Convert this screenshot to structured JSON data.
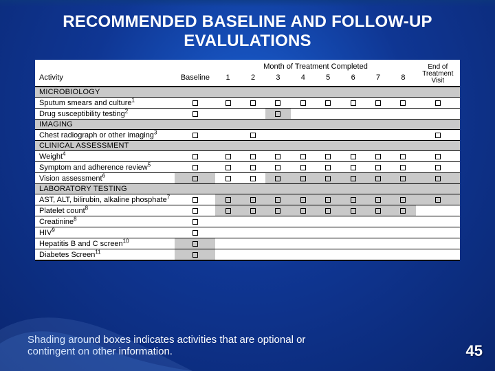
{
  "title_line1": "RECOMMENDED BASELINE AND FOLLOW-UP",
  "title_line2": "EVALULATIONS",
  "page": "45",
  "caption": "Shading around boxes indicates activities that are optional or contingent on other information.",
  "columns": {
    "activity": "Activity",
    "baseline": "Baseline",
    "month_header": "Month of Treatment Completed",
    "months": [
      "1",
      "2",
      "3",
      "4",
      "5",
      "6",
      "7",
      "8"
    ],
    "end_line1": "End of",
    "end_line2": "Treatment",
    "end_line3": "Visit"
  },
  "sections": [
    {
      "name": "MICROBIOLOGY",
      "rows": [
        {
          "label": "Sputum smears and culture",
          "sup": "1",
          "marks": {
            "baseline": true,
            "m": [
              true,
              true,
              true,
              true,
              true,
              true,
              true,
              true
            ],
            "end": true
          },
          "shade": {}
        },
        {
          "label": "Drug susceptibility testing",
          "sup": "2",
          "marks": {
            "baseline": true,
            "m": [
              false,
              false,
              true,
              false,
              false,
              false,
              false,
              false
            ],
            "end": false
          },
          "shade": {
            "3": true
          }
        }
      ]
    },
    {
      "name": "IMAGING",
      "rows": [
        {
          "label": "Chest radiograph or other imaging",
          "sup": "3",
          "marks": {
            "baseline": true,
            "m": [
              false,
              true,
              false,
              false,
              false,
              false,
              false,
              false
            ],
            "end": true
          },
          "shade": {}
        }
      ]
    },
    {
      "name": "CLINICAL ASSESSMENT",
      "rows": [
        {
          "label": "Weight",
          "sup": "4",
          "marks": {
            "baseline": true,
            "m": [
              true,
              true,
              true,
              true,
              true,
              true,
              true,
              true
            ],
            "end": true
          },
          "shade": {}
        },
        {
          "label": "Symptom and adherence review",
          "sup": "5",
          "marks": {
            "baseline": true,
            "m": [
              true,
              true,
              true,
              true,
              true,
              true,
              true,
              true
            ],
            "end": true
          },
          "shade": {}
        },
        {
          "label": "Vision assessment",
          "sup": "6",
          "marks": {
            "baseline": true,
            "m": [
              true,
              true,
              true,
              true,
              true,
              true,
              true,
              true
            ],
            "end": true
          },
          "shade": {
            "baseline": true,
            "3": true,
            "4": true,
            "5": true,
            "6": true,
            "7": true,
            "8": true,
            "end": true
          }
        }
      ]
    },
    {
      "name": "LABORATORY TESTING",
      "rows": [
        {
          "label": "AST, ALT, bilirubin, alkaline phosphate",
          "sup": "7",
          "marks": {
            "baseline": true,
            "m": [
              true,
              true,
              true,
              true,
              true,
              true,
              true,
              true
            ],
            "end": true
          },
          "shade": {
            "1": true,
            "2": true,
            "3": true,
            "4": true,
            "5": true,
            "6": true,
            "7": true,
            "8": true,
            "end": true
          }
        },
        {
          "label": "Platelet count",
          "sup": "8",
          "marks": {
            "baseline": true,
            "m": [
              true,
              true,
              true,
              true,
              true,
              true,
              true,
              true
            ],
            "end": false
          },
          "shade": {
            "1": true,
            "2": true,
            "3": true,
            "4": true,
            "5": true,
            "6": true,
            "7": true,
            "8": true
          }
        },
        {
          "label": "Creatinine",
          "sup": "8",
          "marks": {
            "baseline": true,
            "m": [
              false,
              false,
              false,
              false,
              false,
              false,
              false,
              false
            ],
            "end": false
          },
          "shade": {}
        },
        {
          "label": "HIV",
          "sup": "9",
          "marks": {
            "baseline": true,
            "m": [
              false,
              false,
              false,
              false,
              false,
              false,
              false,
              false
            ],
            "end": false
          },
          "shade": {}
        },
        {
          "label": "Hepatitis B and C screen",
          "sup": "10",
          "marks": {
            "baseline": true,
            "m": [
              false,
              false,
              false,
              false,
              false,
              false,
              false,
              false
            ],
            "end": false
          },
          "shade": {
            "baseline": true
          }
        },
        {
          "label": "Diabetes Screen",
          "sup": "11",
          "marks": {
            "baseline": true,
            "m": [
              false,
              false,
              false,
              false,
              false,
              false,
              false,
              false
            ],
            "end": false
          },
          "shade": {
            "baseline": true
          }
        }
      ]
    }
  ],
  "chart_data": {
    "type": "table",
    "title": "Recommended baseline and follow-up evaluations",
    "columns": [
      "Activity",
      "Baseline",
      "1",
      "2",
      "3",
      "4",
      "5",
      "6",
      "7",
      "8",
      "End of Treatment Visit"
    ],
    "legend": {
      "box": "scheduled",
      "shaded_box": "optional or contingent"
    },
    "sections": [
      {
        "name": "MICROBIOLOGY",
        "rows": [
          {
            "activity": "Sputum smears and culture",
            "baseline": "box",
            "1": "box",
            "2": "box",
            "3": "box",
            "4": "box",
            "5": "box",
            "6": "box",
            "7": "box",
            "8": "box",
            "end": "box"
          },
          {
            "activity": "Drug susceptibility testing",
            "baseline": "box",
            "3": "shaded_box"
          }
        ]
      },
      {
        "name": "IMAGING",
        "rows": [
          {
            "activity": "Chest radiograph or other imaging",
            "baseline": "box",
            "2": "box",
            "end": "box"
          }
        ]
      },
      {
        "name": "CLINICAL ASSESSMENT",
        "rows": [
          {
            "activity": "Weight",
            "baseline": "box",
            "1": "box",
            "2": "box",
            "3": "box",
            "4": "box",
            "5": "box",
            "6": "box",
            "7": "box",
            "8": "box",
            "end": "box"
          },
          {
            "activity": "Symptom and adherence review",
            "baseline": "box",
            "1": "box",
            "2": "box",
            "3": "box",
            "4": "box",
            "5": "box",
            "6": "box",
            "7": "box",
            "8": "box",
            "end": "box"
          },
          {
            "activity": "Vision assessment",
            "baseline": "shaded_box",
            "1": "box",
            "2": "box",
            "3": "shaded_box",
            "4": "shaded_box",
            "5": "shaded_box",
            "6": "shaded_box",
            "7": "shaded_box",
            "8": "shaded_box",
            "end": "shaded_box"
          }
        ]
      },
      {
        "name": "LABORATORY TESTING",
        "rows": [
          {
            "activity": "AST, ALT, bilirubin, alkaline phosphate",
            "baseline": "box",
            "1": "shaded_box",
            "2": "shaded_box",
            "3": "shaded_box",
            "4": "shaded_box",
            "5": "shaded_box",
            "6": "shaded_box",
            "7": "shaded_box",
            "8": "shaded_box",
            "end": "shaded_box"
          },
          {
            "activity": "Platelet count",
            "baseline": "box",
            "1": "shaded_box",
            "2": "shaded_box",
            "3": "shaded_box",
            "4": "shaded_box",
            "5": "shaded_box",
            "6": "shaded_box",
            "7": "shaded_box",
            "8": "shaded_box"
          },
          {
            "activity": "Creatinine",
            "baseline": "box"
          },
          {
            "activity": "HIV",
            "baseline": "box"
          },
          {
            "activity": "Hepatitis B and C screen",
            "baseline": "shaded_box"
          },
          {
            "activity": "Diabetes Screen",
            "baseline": "shaded_box"
          }
        ]
      }
    ]
  }
}
